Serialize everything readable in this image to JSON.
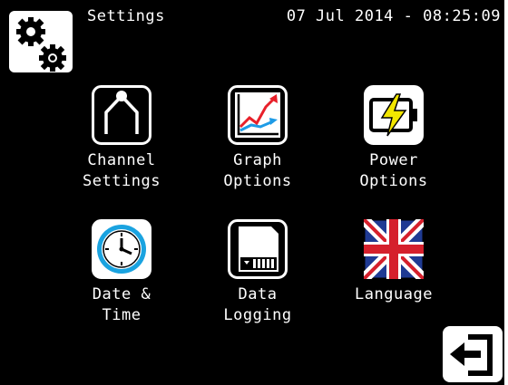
{
  "header": {
    "title": "Settings",
    "datetime": "07 Jul 2014 - 08:25:09"
  },
  "tiles": [
    {
      "line1": "Channel",
      "line2": "Settings",
      "icon": "probe-icon"
    },
    {
      "line1": "Graph",
      "line2": "Options",
      "icon": "graph-icon"
    },
    {
      "line1": "Power",
      "line2": "Options",
      "icon": "battery-icon"
    },
    {
      "line1": "Date &",
      "line2": "Time",
      "icon": "clock-icon"
    },
    {
      "line1": "Data",
      "line2": "Logging",
      "icon": "sd-card-icon"
    },
    {
      "line1": "Language",
      "line2": "",
      "icon": "uk-flag-icon"
    }
  ],
  "icons": {
    "settings": "gears-icon",
    "exit": "exit-icon"
  },
  "colors": {
    "background": "#000000",
    "foreground": "#ffffff",
    "graph_red": "#e8202a",
    "graph_blue": "#1e9be6",
    "lightning": "#f2e600",
    "clock_ring": "#1aa3e0",
    "flag_blue": "#1f3a93",
    "flag_red": "#d5202c"
  }
}
